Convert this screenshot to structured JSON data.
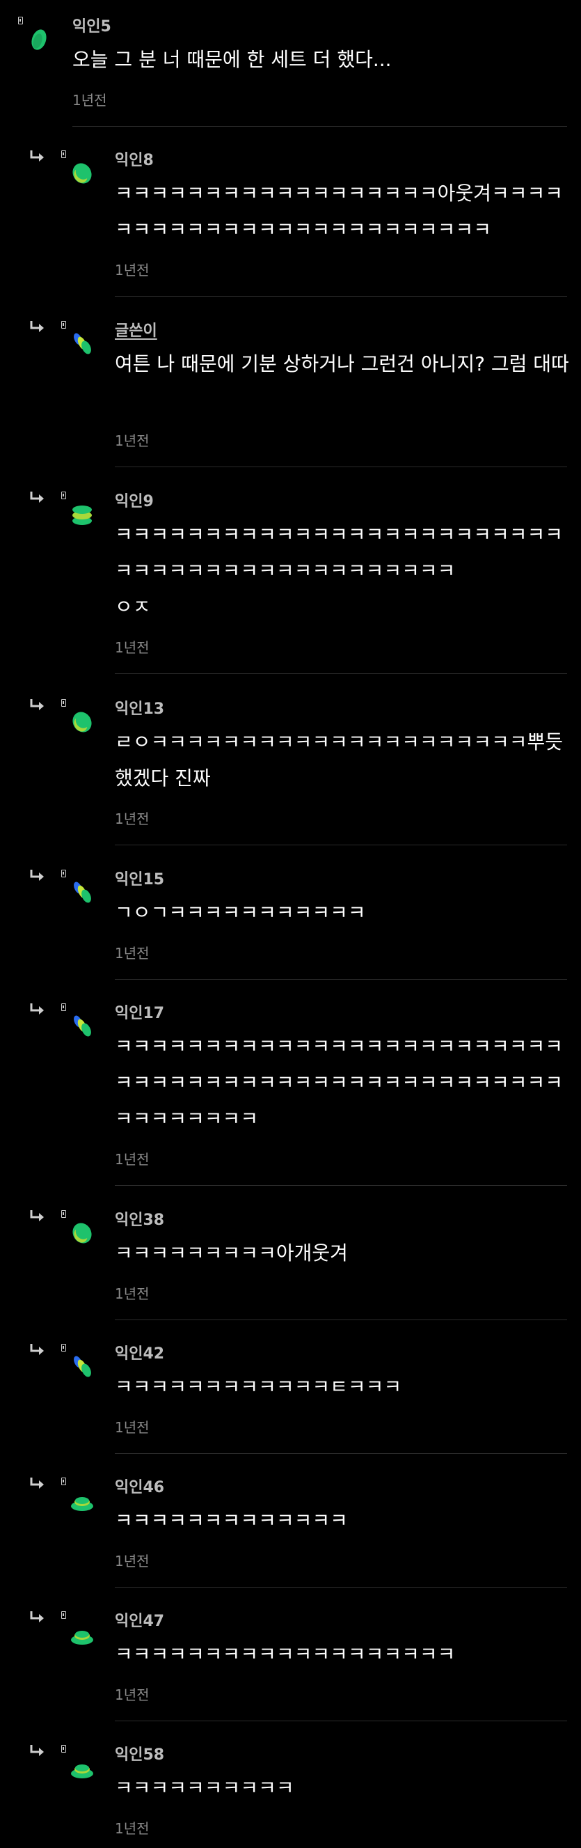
{
  "colors": {
    "background": "#000000",
    "author": "#bdbdbd",
    "body": "#ffffff",
    "timestamp": "#8a8a8a",
    "divider": "#2c2c2c",
    "avatar_green": "#1ec26c",
    "avatar_yellow": "#c6e83a",
    "avatar_blue": "#2a6cf0"
  },
  "comments": [
    {
      "author": "익인5",
      "body": "오늘 그 분 너 때문에 한 세트 더 했다...",
      "time": "1년전",
      "reply": false,
      "op": false,
      "avatar": "green-oval-avatar-icon"
    },
    {
      "author": "익인8",
      "body": "ㅋㅋㅋㅋㅋㅋㅋㅋㅋㅋㅋㅋㅋㅋㅋㅋㅋㅋ아웃겨ㅋㅋㅋㅋㅋㅋㅋㅋㅋㅋㅋㅋㅋㅋㅋㅋㅋㅋㅋㅋㅋㅋㅋㅋㅋ",
      "time": "1년전",
      "reply": true,
      "op": false,
      "avatar": "green-oval-avatar-icon"
    },
    {
      "author": "글쓴이",
      "body": "여튼 나 때문에 기분 상하거나 그런건 아니지? 그럼 대따",
      "time": "1년전",
      "reply": true,
      "op": true,
      "avatar": "blue-yellow-green-avatar-icon"
    },
    {
      "author": "익인9",
      "body": "ㅋㅋㅋㅋㅋㅋㅋㅋㅋㅋㅋㅋㅋㅋㅋㅋㅋㅋㅋㅋㅋㅋㅋㅋㅋㅋㅋㅋㅋㅋㅋㅋㅋㅋㅋㅋㅋㅋㅋㅋㅋㅋㅋㅋ\nㅇㅈ",
      "time": "1년전",
      "reply": true,
      "op": false,
      "avatar": "stacked-discs-avatar-icon"
    },
    {
      "author": "익인13",
      "body": "ㄹㅇㅋㅋㅋㅋㅋㅋㅋㅋㅋㅋㅋㅋㅋㅋㅋㅋㅋㅋㅋㅋㅋ뿌듯했겠다 진짜",
      "time": "1년전",
      "reply": true,
      "op": false,
      "avatar": "green-oval-avatar-icon"
    },
    {
      "author": "익인15",
      "body": "ㄱㅇㄱㅋㅋㅋㅋㅋㅋㅋㅋㅋㅋㅋ",
      "time": "1년전",
      "reply": true,
      "op": false,
      "avatar": "blue-yellow-green-avatar-icon"
    },
    {
      "author": "익인17",
      "body": "ㅋㅋㅋㅋㅋㅋㅋㅋㅋㅋㅋㅋㅋㅋㅋㅋㅋㅋㅋㅋㅋㅋㅋㅋㅋㅋㅋㅋㅋㅋㅋㅋㅋㅋㅋㅋㅋㅋㅋㅋㅋㅋㅋㅋㅋㅋㅋㅋㅋㅋㅋㅋㅋㅋㅋㅋㅋㅋ",
      "time": "1년전",
      "reply": true,
      "op": false,
      "avatar": "blue-yellow-green-avatar-icon"
    },
    {
      "author": "익인38",
      "body": "ㅋㅋㅋㅋㅋㅋㅋㅋㅋ아개웃겨",
      "time": "1년전",
      "reply": true,
      "op": false,
      "avatar": "green-oval-avatar-icon"
    },
    {
      "author": "익인42",
      "body": "ㅋㅋㅋㅋㅋㅋㅋㅋㅋㅋㅋㅋㅌㅋㅋㅋ",
      "time": "1년전",
      "reply": true,
      "op": false,
      "avatar": "blue-yellow-green-avatar-icon"
    },
    {
      "author": "익인46",
      "body": "ㅋㅋㅋㅋㅋㅋㅋㅋㅋㅋㅋㅋㅋ",
      "time": "1년전",
      "reply": true,
      "op": false,
      "avatar": "green-mound-avatar-icon"
    },
    {
      "author": "익인47",
      "body": "ㅋㅋㅋㅋㅋㅋㅋㅋㅋㅋㅋㅋㅋㅋㅋㅋㅋㅋㅋ",
      "time": "1년전",
      "reply": true,
      "op": false,
      "avatar": "green-mound-avatar-icon"
    },
    {
      "author": "익인58",
      "body": "ㅋㅋㅋㅋㅋㅋㅋㅋㅋㅋ",
      "time": "1년전",
      "reply": true,
      "op": false,
      "avatar": "green-mound-avatar-icon"
    }
  ]
}
